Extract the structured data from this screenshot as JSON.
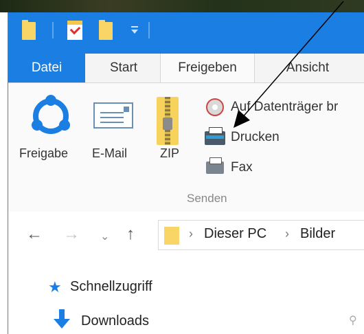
{
  "tabs": [
    {
      "label": "Datei"
    },
    {
      "label": "Start"
    },
    {
      "label": "Freigeben"
    },
    {
      "label": "Ansicht"
    }
  ],
  "ribbon": {
    "share_label": "Freigabe",
    "email_label": "E-Mail",
    "zip_label": "ZIP",
    "burn_label": "Auf Datenträger br",
    "print_label": "Drucken",
    "fax_label": "Fax",
    "group_label": "Senden"
  },
  "address": {
    "crumbs": [
      "Dieser PC",
      "Bilder"
    ]
  },
  "navpane": {
    "quick_access": "Schnellzugriff",
    "downloads": "Downloads"
  },
  "colors": {
    "accent": "#1a7ee3",
    "folder": "#f9d568"
  },
  "icons": [
    "folder-icon",
    "checkmark-icon",
    "customize-dropdown-icon",
    "share-icon",
    "email-icon",
    "zip-icon",
    "burn-disc-icon",
    "printer-icon",
    "fax-icon",
    "back-arrow-icon",
    "forward-arrow-icon",
    "recent-chevron-icon",
    "up-arrow-icon",
    "star-icon",
    "download-icon",
    "pin-icon"
  ]
}
